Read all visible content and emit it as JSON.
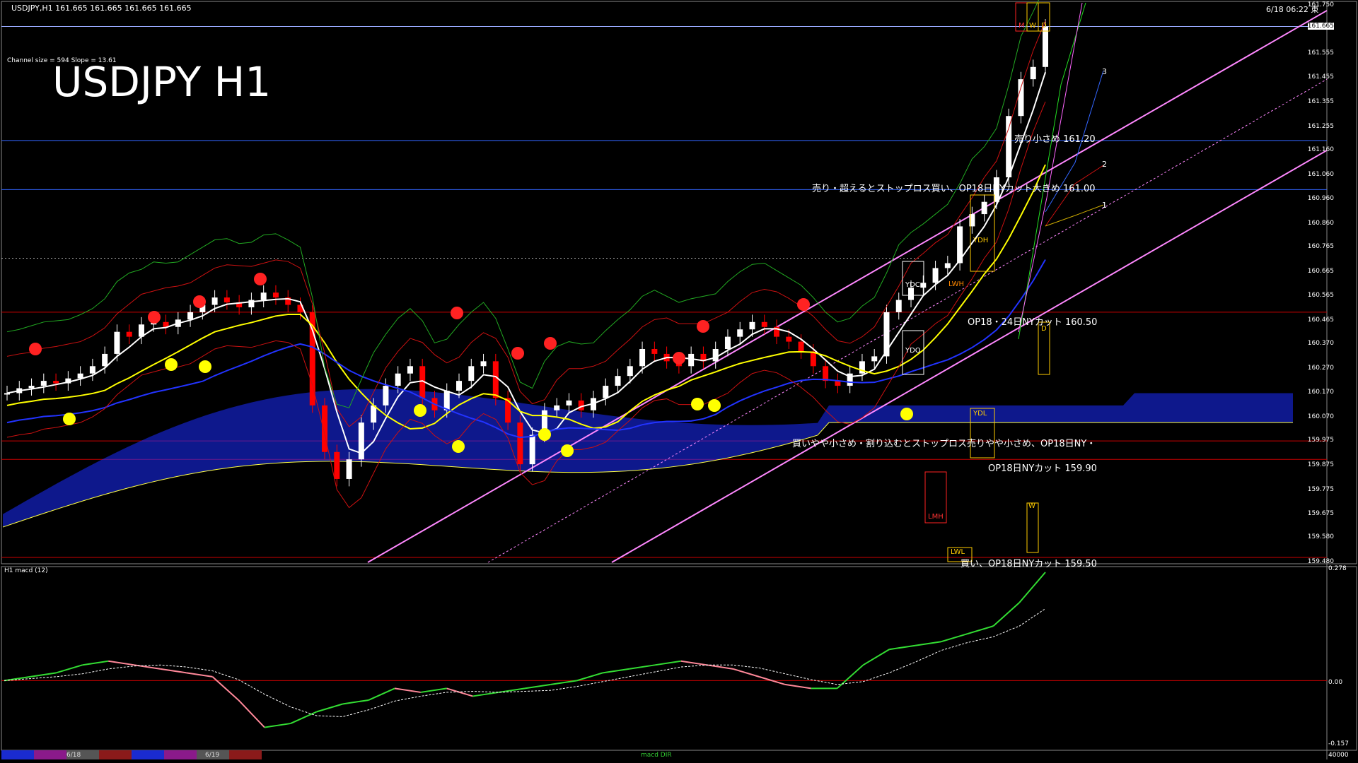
{
  "header": {
    "symbol_info": "USDJPY,H1  161.665 161.665 161.665 161.665",
    "datetime": "6/18 06:22 東"
  },
  "overlay": {
    "title": "USDJPY H1",
    "channel_info": "Channel size = 594 Slope = 13.61"
  },
  "annotations": {
    "sell_small": "売り小さめ 161.20",
    "sell_big": "売り・超えるとストップロス買い、OP18日NYカット大きめ 161.00",
    "op_2450": "OP18・24日NYカット 160.50",
    "buy_small": "買いやや小さめ・割り込むとストップロス売りやや小さめ、OP18日NY・",
    "op_1590": "OP18日NYカット 159.90",
    "op_1595": "買い、OP18日NYカット 159.50",
    "ch1": "1",
    "ch2": "2",
    "ch3": "3"
  },
  "boxes": {
    "ydh": "YDH",
    "ydc": "YDC",
    "ydo": "YDO",
    "ydl": "YDL",
    "lmh": "LMH",
    "lwl": "LWL",
    "w": "W",
    "d": "D",
    "m": "M",
    "lwh": "LWH"
  },
  "price_axis": {
    "labels": [
      "161.750",
      "161.665",
      "161.555",
      "161.455",
      "161.355",
      "161.255",
      "161.160",
      "161.060",
      "160.960",
      "160.860",
      "160.765",
      "160.665",
      "160.565",
      "160.465",
      "160.370",
      "160.270",
      "160.170",
      "160.070",
      "159.975",
      "159.875",
      "159.775",
      "159.675",
      "159.580",
      "159.480"
    ],
    "current": "161.665"
  },
  "macd_axis": {
    "title": "H1 macd (12)",
    "labels": [
      "0.278",
      "0.00",
      "-0.157"
    ],
    "bottom": "40000"
  },
  "timebar": {
    "labels": [
      "6/18",
      "6/19"
    ],
    "macd_tag": "macd DIR"
  },
  "colors": {
    "bull": "#ffffff",
    "bear": "#ff0000",
    "ichimoku_cloud": "#1a2bff",
    "kijun": "#ffff00",
    "channel": "#ff88ff",
    "macd_up": "#33dd33",
    "macd_down": "#ff8899",
    "hline_red": "#cc0000",
    "hline_blue": "#3366ff"
  },
  "chart_data": {
    "type": "line",
    "title": "USDJPY H1",
    "ylim": [
      159.48,
      161.75
    ],
    "close_series": {
      "name": "USDJPY",
      "values": [
        160.17,
        160.19,
        160.2,
        160.22,
        160.21,
        160.23,
        160.25,
        160.28,
        160.33,
        160.42,
        160.4,
        160.45,
        160.46,
        160.44,
        160.47,
        160.5,
        160.53,
        160.56,
        160.54,
        160.52,
        160.55,
        160.58,
        160.56,
        160.53,
        160.5,
        160.12,
        159.93,
        159.82,
        159.9,
        160.05,
        160.12,
        160.2,
        160.25,
        160.28,
        160.15,
        160.1,
        160.18,
        160.22,
        160.28,
        160.3,
        160.15,
        160.05,
        159.88,
        160.0,
        160.1,
        160.12,
        160.14,
        160.1,
        160.15,
        160.2,
        160.24,
        160.28,
        160.35,
        160.33,
        160.3,
        160.28,
        160.33,
        160.3,
        160.35,
        160.4,
        160.43,
        160.46,
        160.44,
        160.4,
        160.38,
        160.34,
        160.28,
        160.22,
        160.2,
        160.25,
        160.3,
        160.32,
        160.5,
        160.55,
        160.6,
        160.62,
        160.68,
        160.7,
        160.85,
        160.9,
        160.95,
        161.05,
        161.3,
        161.45,
        161.5,
        161.665
      ]
    },
    "macd": {
      "ylim": [
        -0.157,
        0.278
      ],
      "values": [
        0.0,
        0.01,
        0.02,
        0.04,
        0.05,
        0.04,
        0.03,
        0.02,
        0.01,
        -0.05,
        -0.12,
        -0.11,
        -0.08,
        -0.06,
        -0.05,
        -0.02,
        -0.03,
        -0.02,
        -0.04,
        -0.03,
        -0.02,
        -0.01,
        0.0,
        0.02,
        0.03,
        0.04,
        0.05,
        0.04,
        0.03,
        0.01,
        -0.01,
        -0.02,
        -0.02,
        0.04,
        0.08,
        0.09,
        0.1,
        0.12,
        0.14,
        0.2,
        0.278
      ]
    }
  }
}
